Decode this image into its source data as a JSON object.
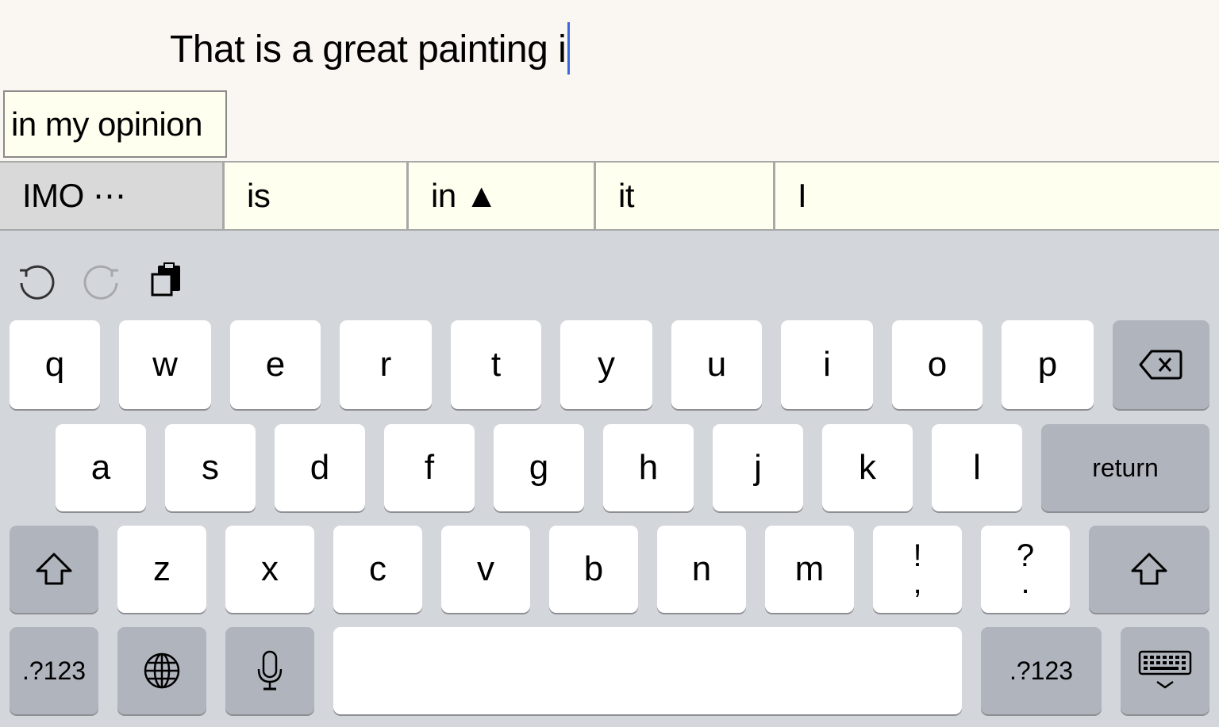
{
  "editor": {
    "typed_text": "That is a great painting i",
    "caret_color": "#3a66e0"
  },
  "phrase_suggestion": "in my opinion",
  "suggestions": [
    {
      "label": "IMO ⋯",
      "primary": true
    },
    {
      "label": "is"
    },
    {
      "label": "in ▲"
    },
    {
      "label": "it"
    },
    {
      "label": "I"
    }
  ],
  "toolbar": {
    "undo_icon": "undo-icon",
    "redo_icon": "redo-icon",
    "paste_icon": "clipboard-paste-icon"
  },
  "keys": {
    "row1": [
      "q",
      "w",
      "e",
      "r",
      "t",
      "y",
      "u",
      "i",
      "o",
      "p"
    ],
    "row2": [
      "a",
      "s",
      "d",
      "f",
      "g",
      "h",
      "j",
      "k",
      "l"
    ],
    "row3": [
      "z",
      "x",
      "c",
      "v",
      "b",
      "n",
      "m"
    ],
    "punct1": {
      "top": "!",
      "bottom": ","
    },
    "punct2": {
      "top": "?",
      "bottom": "."
    },
    "return": "return",
    "numbers_left": ".?123",
    "numbers_right": ".?123",
    "space": ""
  },
  "colors": {
    "background": "#faf7f2",
    "suggestion_bg": "#fffff0",
    "keyboard_bg": "#d3d6db",
    "function_key": "#b0b4bd"
  }
}
